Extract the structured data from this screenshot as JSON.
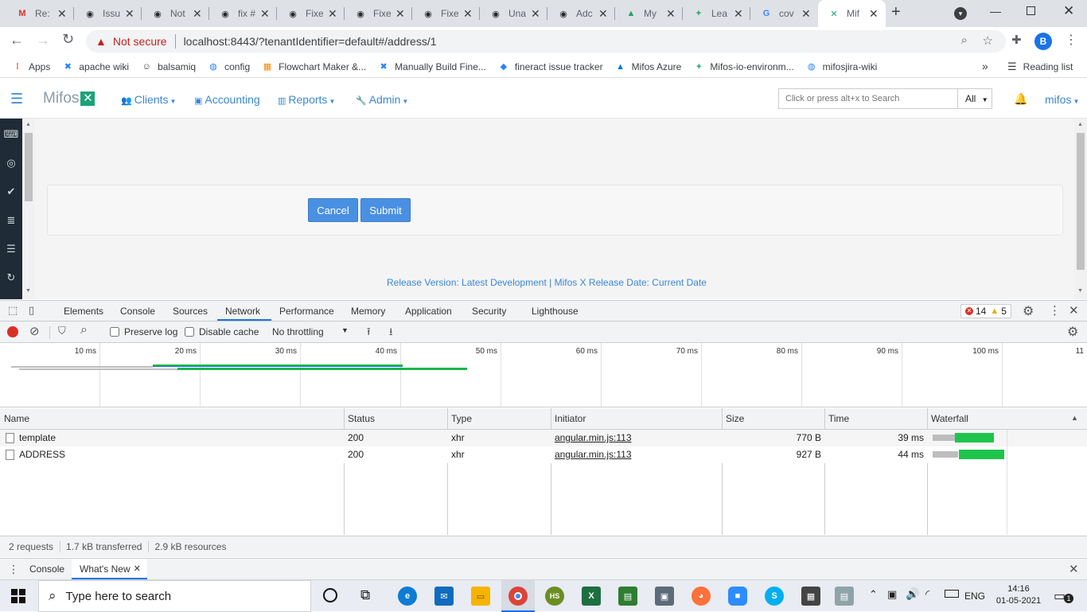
{
  "browser": {
    "tabs": [
      {
        "label": "Re:",
        "icon": "gmail-icon",
        "color": "#d93025",
        "glyph": "M"
      },
      {
        "label": "Issu",
        "icon": "github-icon",
        "color": "#24292e",
        "glyph": "◉"
      },
      {
        "label": "Not",
        "icon": "github-icon",
        "color": "#24292e",
        "glyph": "◉"
      },
      {
        "label": "fix #",
        "icon": "github-icon",
        "color": "#24292e",
        "glyph": "◉"
      },
      {
        "label": "Fixe",
        "icon": "github-icon",
        "color": "#24292e",
        "glyph": "◉"
      },
      {
        "label": "Fixe",
        "icon": "github-icon",
        "color": "#24292e",
        "glyph": "◉"
      },
      {
        "label": "Fixe",
        "icon": "github-icon",
        "color": "#24292e",
        "glyph": "◉"
      },
      {
        "label": "Una",
        "icon": "github-icon",
        "color": "#24292e",
        "glyph": "◉"
      },
      {
        "label": "Adc",
        "icon": "github-icon",
        "color": "#24292e",
        "glyph": "◉"
      },
      {
        "label": "My",
        "icon": "drive-icon",
        "color": "#1fa463",
        "glyph": "▲"
      },
      {
        "label": "Lea",
        "icon": "sheets-icon",
        "color": "#0f9d58",
        "glyph": "+"
      },
      {
        "label": "cov",
        "icon": "google-icon",
        "color": "#4285f4",
        "glyph": "G"
      },
      {
        "label": "Mif",
        "icon": "mifos-icon",
        "color": "#1aa37a",
        "glyph": "✕"
      }
    ],
    "new_tab": "+",
    "security_label": "Not secure",
    "url": "localhost:8443/?tenantIdentifier=default#/address/1",
    "profile_initial": "B",
    "bookmarks": [
      {
        "label": "Apps",
        "icon": "apps-grid-icon",
        "color": "#e8453c",
        "glyph": "⁞"
      },
      {
        "label": "apache wiki",
        "icon": "confluence-icon",
        "color": "#2684ff",
        "glyph": "✖"
      },
      {
        "label": "balsamiq",
        "icon": "balsamiq-icon",
        "color": "#333333",
        "glyph": "☺"
      },
      {
        "label": "config",
        "icon": "jira-icon",
        "color": "#2684ff",
        "glyph": "◍"
      },
      {
        "label": "Flowchart Maker &...",
        "icon": "drawio-icon",
        "color": "#f08705",
        "glyph": "▦"
      },
      {
        "label": "Manually Build Fine...",
        "icon": "confluence-icon",
        "color": "#2684ff",
        "glyph": "✖"
      },
      {
        "label": "fineract issue tracker",
        "icon": "jira-icon",
        "color": "#2684ff",
        "glyph": "◆"
      },
      {
        "label": "Mifos Azure",
        "icon": "azure-icon",
        "color": "#0078d4",
        "glyph": "▲"
      },
      {
        "label": "Mifos-io-environm...",
        "icon": "sheets-icon",
        "color": "#0f9d58",
        "glyph": "+"
      },
      {
        "label": "mifosjira-wiki",
        "icon": "jira-icon",
        "color": "#2684ff",
        "glyph": "◍"
      }
    ],
    "more": "»",
    "reading_list": "Reading list"
  },
  "app": {
    "logo_text": "Mifos",
    "nav": [
      {
        "label": "Clients",
        "icon": "users-icon",
        "glyph": "👥"
      },
      {
        "label": "Accounting",
        "icon": "money-icon",
        "glyph": "▣"
      },
      {
        "label": "Reports",
        "icon": "chart-icon",
        "glyph": "▥"
      },
      {
        "label": "Admin",
        "icon": "wrench-icon",
        "glyph": "🔧"
      }
    ],
    "search_placeholder": "Click or press alt+x to Search",
    "search_scope": "All",
    "user": "mifos",
    "cancel": "Cancel",
    "submit": "Submit",
    "footer": "Release Version: Latest Development | Mifos X Release Date: Current Date",
    "accent": "#3a87d6",
    "button_color": "#4a90e2"
  },
  "devtools": {
    "tabs": [
      "Elements",
      "Console",
      "Sources",
      "Network",
      "Performance",
      "Memory",
      "Application",
      "Security",
      "Lighthouse"
    ],
    "active_tab": "Network",
    "errors": "14",
    "warnings": "5",
    "preserve_log": "Preserve log",
    "disable_cache": "Disable cache",
    "throttling": "No throttling",
    "ticks": [
      "10 ms",
      "20 ms",
      "30 ms",
      "40 ms",
      "50 ms",
      "60 ms",
      "70 ms",
      "80 ms",
      "90 ms",
      "100 ms",
      "11"
    ],
    "columns": [
      "Name",
      "Status",
      "Type",
      "Initiator",
      "Size",
      "Time",
      "Waterfall"
    ],
    "rows": [
      {
        "name": "template",
        "status": "200",
        "type": "xhr",
        "initiator": "angular.min.js:113",
        "size": "770 B",
        "time": "39 ms"
      },
      {
        "name": "ADDRESS",
        "status": "200",
        "type": "xhr",
        "initiator": "angular.min.js:113",
        "size": "927 B",
        "time": "44 ms"
      }
    ],
    "summary": [
      "2 requests",
      "1.7 kB transferred",
      "2.9 kB resources"
    ],
    "drawer_tabs": [
      "Console",
      "What's New"
    ]
  },
  "taskbar": {
    "search_placeholder": "Type here to search",
    "language": "ENG",
    "time": "14:16",
    "date": "01-05-2021",
    "notifications": "1"
  }
}
